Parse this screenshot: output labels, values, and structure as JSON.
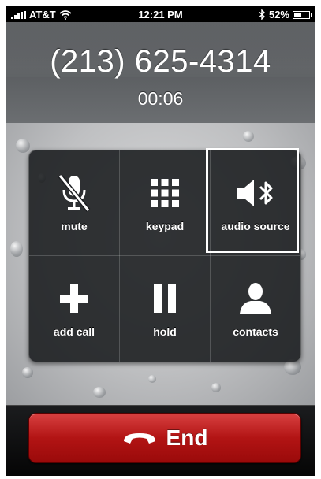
{
  "status_bar": {
    "carrier": "AT&T",
    "time": "12:21 PM",
    "battery_percent": "52%",
    "battery_level": 0.52,
    "icons": [
      "signal-icon",
      "wifi-icon",
      "bluetooth-icon",
      "battery-icon"
    ]
  },
  "call": {
    "number": "(213) 625-4314",
    "duration": "00:06"
  },
  "controls": [
    {
      "label": "mute",
      "icon": "mute-icon"
    },
    {
      "label": "keypad",
      "icon": "keypad-icon"
    },
    {
      "label": "audio source",
      "icon": "speaker-bluetooth-icon"
    },
    {
      "label": "add call",
      "icon": "plus-icon"
    },
    {
      "label": "hold",
      "icon": "pause-icon"
    },
    {
      "label": "contacts",
      "icon": "person-icon"
    }
  ],
  "end_button": {
    "label": "End",
    "icon": "hang-up-icon"
  },
  "colors": {
    "end_red": "#b21414",
    "panel": "#1c1e21",
    "highlight": "#ffffff"
  }
}
